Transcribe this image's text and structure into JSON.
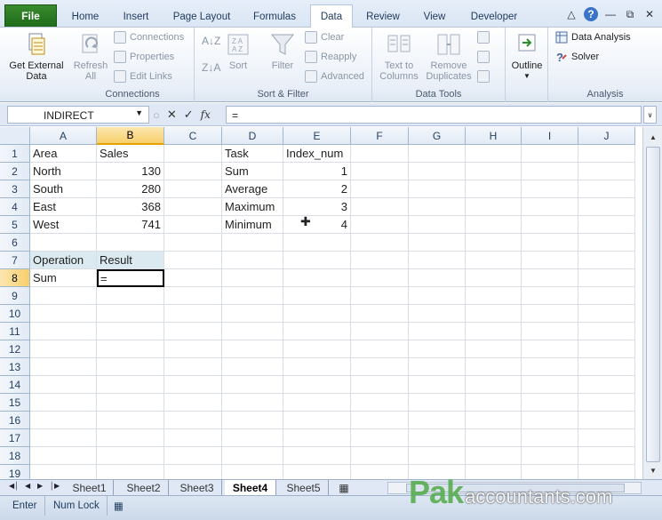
{
  "ribbon": {
    "file_tab": "File",
    "tabs": [
      "Home",
      "Insert",
      "Page Layout",
      "Formulas",
      "Data",
      "Review",
      "View",
      "Developer"
    ],
    "active_tab": "Data",
    "groups": {
      "connections": {
        "label": "Connections",
        "get_external_data_line1": "Get External",
        "get_external_data_line2": "Data",
        "refresh_line1": "Refresh",
        "refresh_line2": "All",
        "connections": "Connections",
        "properties": "Properties",
        "edit_links": "Edit Links"
      },
      "sort_filter": {
        "label": "Sort & Filter",
        "sort": "Sort",
        "filter": "Filter",
        "clear": "Clear",
        "reapply": "Reapply",
        "advanced": "Advanced"
      },
      "data_tools": {
        "label": "Data Tools",
        "text_to_columns_line1": "Text to",
        "text_to_columns_line2": "Columns",
        "remove_duplicates_line1": "Remove",
        "remove_duplicates_line2": "Duplicates"
      },
      "outline": {
        "outline": "Outline"
      },
      "analysis": {
        "label": "Analysis",
        "data_analysis": "Data Analysis",
        "solver": "Solver"
      }
    },
    "accent_color": "#1f6b1a"
  },
  "formula_bar": {
    "name_box": "INDIRECT",
    "formula": "="
  },
  "grid": {
    "columns": [
      "A",
      "B",
      "C",
      "D",
      "E",
      "F",
      "G",
      "H",
      "I",
      "J"
    ],
    "rows": [
      "1",
      "2",
      "3",
      "4",
      "5",
      "6",
      "7",
      "8",
      "9",
      "10",
      "11",
      "12",
      "13",
      "14",
      "15",
      "16",
      "17",
      "18",
      "19"
    ],
    "selected_column": "B",
    "selected_row": "8",
    "cells": {
      "A1": "Area",
      "B1": "Sales",
      "A2": "North",
      "B2": "130",
      "A3": "South",
      "B3": "280",
      "A4": "East",
      "B4": "368",
      "A5": "West",
      "B5": "741",
      "D1": "Task",
      "E1": "Index_num",
      "D2": "Sum",
      "E2": "1",
      "D3": "Average",
      "E3": "2",
      "D4": "Maximum",
      "E4": "3",
      "D5": "Minimum",
      "E5": "4",
      "A7": "Operation",
      "B7": "Result",
      "A8": "Sum",
      "B8": "="
    }
  },
  "sheets": {
    "tabs": [
      "Sheet1",
      "Sheet2",
      "Sheet3",
      "Sheet4",
      "Sheet5"
    ],
    "active": "Sheet4"
  },
  "status_bar": {
    "mode": "Enter",
    "num_lock": "Num Lock"
  },
  "watermark": {
    "part1": "Pak",
    "part2": "accountants.com"
  }
}
